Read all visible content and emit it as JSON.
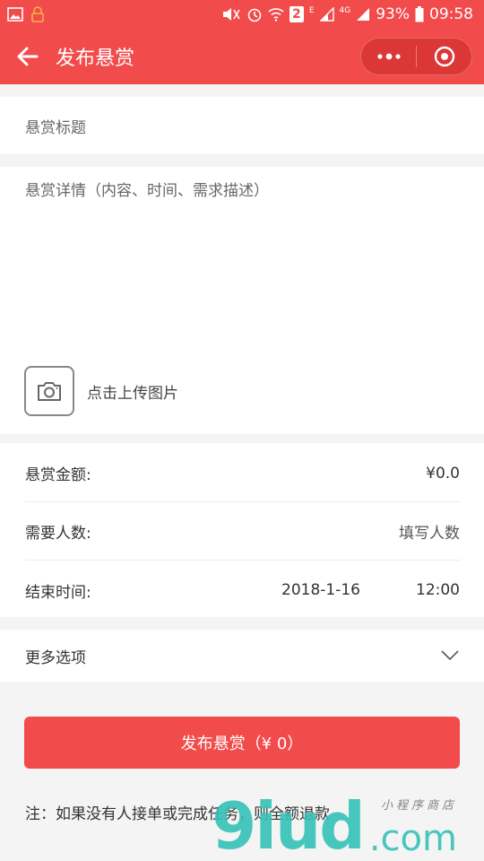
{
  "status_bar": {
    "battery": "93%",
    "time": "09:58",
    "sim_badge": "2",
    "network_e": "E",
    "network_4g": "4G"
  },
  "nav": {
    "title": "发布悬赏"
  },
  "form": {
    "title_placeholder": "悬赏标题",
    "detail_placeholder": "悬赏详情（内容、时间、需求描述）",
    "upload_label": "点击上传图片",
    "amount_label": "悬赏金额:",
    "amount_value": "¥0.0",
    "people_label": "需要人数:",
    "people_placeholder": "填写人数",
    "end_time_label": "结束时间:",
    "end_date": "2018-1-16",
    "end_time": "12:00",
    "more_options": "更多选项"
  },
  "publish_button": "发布悬赏（¥ 0）",
  "note": "注：如果没有人接单或完成任务，则全额退款",
  "watermark": {
    "big": "9iud",
    "com": ".com",
    "small": "小程序商店"
  },
  "colors": {
    "accent": "#f24b4b",
    "watermark": "#34c2b8"
  }
}
